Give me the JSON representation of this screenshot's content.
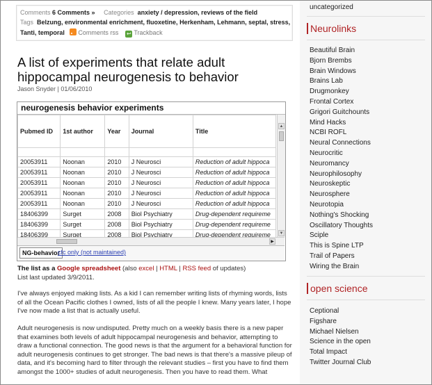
{
  "meta": {
    "comments_label": "Comments",
    "comments_link": "6 Comments »",
    "categories_label": "Categories",
    "categories_value": "anxiety / depression, reviews of the field",
    "tags_label": "Tags",
    "tags_line1": "Belzung, environmental enrichment, fluoxetine, Herkenham, Lehmann, septal, stress,",
    "tags_line2": "Tanti, temporal",
    "comments_rss": "Comments rss",
    "trackback": "Trackback"
  },
  "post": {
    "title": "A list of experiments that relate adult hippocampal neurogenesis to behavior",
    "byline": "Jason Snyder | 01/06/2010"
  },
  "sheet": {
    "title": "neurogenesis behavior experiments",
    "columns": [
      "Pubmed ID",
      "1st author",
      "Year",
      "Journal",
      "Title"
    ],
    "rows": [
      [
        "20053911",
        "Noonan",
        "2010",
        "J Neurosci",
        "Reduction of adult hippoca"
      ],
      [
        "20053911",
        "Noonan",
        "2010",
        "J Neurosci",
        "Reduction of adult hippoca"
      ],
      [
        "20053911",
        "Noonan",
        "2010",
        "J Neurosci",
        "Reduction of adult hippoca"
      ],
      [
        "20053911",
        "Noonan",
        "2010",
        "J Neurosci",
        "Reduction of adult hippoca"
      ],
      [
        "20053911",
        "Noonan",
        "2010",
        "J Neurosci",
        "Reduction of adult hippoca"
      ],
      [
        "18406399",
        "Surget",
        "2008",
        "Biol Psychiatry",
        "Drug-dependent requireme"
      ],
      [
        "18406399",
        "Surget",
        "2008",
        "Biol Psychiatry",
        "Drug-dependent requireme"
      ],
      [
        "18406399",
        "Surget",
        "2008",
        "Biol Psychiatry",
        "Drug-dependent requireme"
      ]
    ],
    "tab_active": "NG-behavior",
    "tab_other": "cfc only (not maintained)"
  },
  "body": {
    "list_pre": "The list as a ",
    "list_link": "Google spreadsheet",
    "list_also": " (also ",
    "excel": "excel",
    "sep1": " | ",
    "html": "HTML",
    "sep2": " | ",
    "rss": "RSS feed",
    "list_post": " of updates)",
    "updated": "List last updated 3/9/2011.",
    "para1": "I've always enjoyed making lists. As a kid I can remember writing lists of rhyming words, lists of all the Ocean Pacific clothes I owned, lists of all the people I knew. Many years later, I hope I've now made a list that is actually useful.",
    "para2": "Adult neurogenesis is now undisputed. Pretty much on a weekly basis there is a new paper that examines both levels of adult hippocampal neurogenesis and behavior, attempting to draw a functional connection. The good news is that the argument for a behavioral function for adult neurogenesis continues to get stronger. The bad news is that there's a massive pileup of data, and it's becoming hard to filter through the relevant studies – first you have to find them amongst the 1000+ studies of adult neurogenesis. Then you have to read them. What"
  },
  "sidebar": {
    "uncategorized": "uncategorized",
    "neurolinks_title": "Neurolinks",
    "neurolinks": [
      "Beautiful Brain",
      "Bjorn Brembs",
      "Brain Windows",
      "Brains Lab",
      "Drugmonkey",
      "Frontal Cortex",
      "Grigori Guitchounts",
      "Mind Hacks",
      "NCBI ROFL",
      "Neural Connections",
      "Neurocritic",
      "Neuromancy",
      "Neurophilosophy",
      "Neuroskeptic",
      "Neurosphere",
      "Neurotopia",
      "Nothing's Shocking",
      "Oscillatory Thoughts",
      "Sciple",
      "This is Spine LTP",
      "Trail of Papers",
      "Wiring the Brain"
    ],
    "open_title": "open science",
    "open_links": [
      "Ceptional",
      "Figshare",
      "Michael Nielsen",
      "Science in the open",
      "Total Impact",
      "Twitter Journal Club"
    ]
  },
  "colors": {
    "accent": "#b02325",
    "link_blue": "#2a3fb3"
  }
}
